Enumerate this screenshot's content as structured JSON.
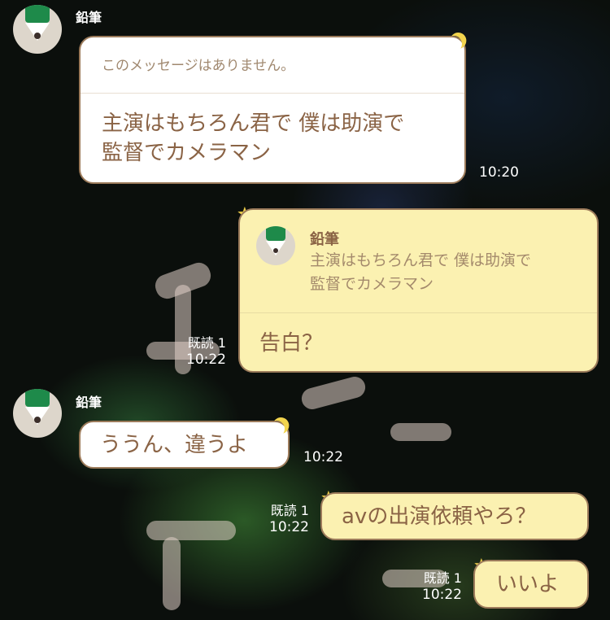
{
  "messages": [
    {
      "sender": "鉛筆",
      "quote_unavailable": "このメッセージはありません。",
      "text_line1": "主演はもちろん君で 僕は助演で",
      "text_line2": "監督でカメラマン",
      "time": "10:20"
    },
    {
      "reply_to_name": "鉛筆",
      "reply_line1": "主演はもちろん君で 僕は助演で",
      "reply_line2": "監督でカメラマン",
      "text": "告白？",
      "read": "既読 1",
      "time": "10:22"
    },
    {
      "sender": "鉛筆",
      "text": "ううん、違うよ",
      "time": "10:22"
    },
    {
      "text": "avの出演依頼やろ？",
      "read": "既読 1",
      "time": "10:22"
    },
    {
      "text": "いいよ",
      "read": "既読 1",
      "time": "10:22"
    }
  ],
  "colors": {
    "incoming_bubble": "#ffffff",
    "outgoing_bubble": "#fbf1b1",
    "bubble_border": "#9c7b5b",
    "bubble_text": "#8a6345",
    "avatar_green": "#1e8a4a"
  },
  "icons": [
    "pencil-avatar-icon",
    "moon-decoration-icon",
    "star-decoration-icon"
  ]
}
